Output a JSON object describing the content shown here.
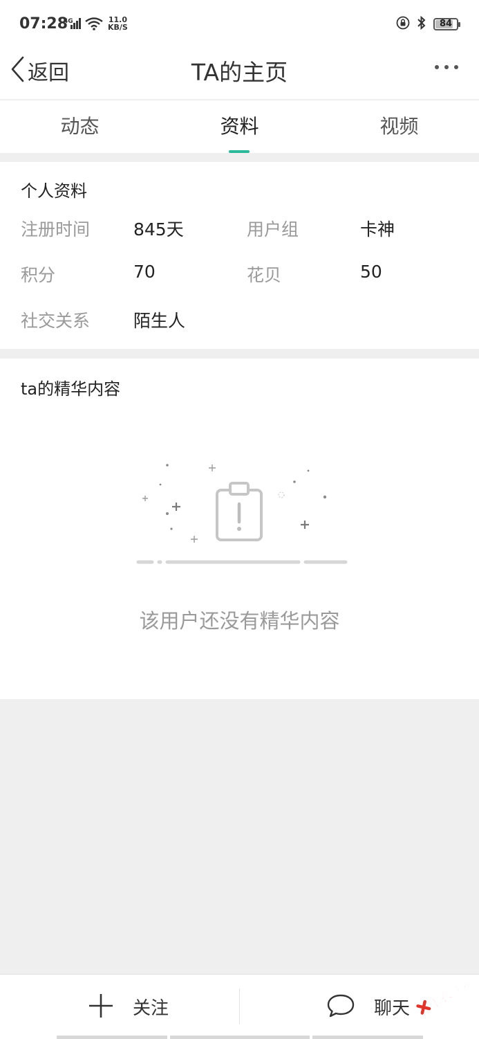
{
  "status_bar": {
    "time": "07:28",
    "network": "4G",
    "speed_value": "11.0",
    "speed_unit": "KB/S",
    "battery_level": "84",
    "icons": [
      "signal-icon",
      "wifi-icon",
      "rotation-lock-icon",
      "bluetooth-icon",
      "battery-icon"
    ]
  },
  "header": {
    "back_label": "返回",
    "title": "TA的主页",
    "more_icon": "more-dots-icon"
  },
  "tabs": [
    {
      "label": "动态",
      "active": false
    },
    {
      "label": "资料",
      "active": true
    },
    {
      "label": "视频",
      "active": false
    }
  ],
  "accent_color": "#2bb99a",
  "profile": {
    "section_title": "个人资料",
    "fields": [
      {
        "label": "注册时间",
        "value": "845天"
      },
      {
        "label": "用户组",
        "value": "卡神"
      },
      {
        "label": "积分",
        "value": "70"
      },
      {
        "label": "花贝",
        "value": "50"
      },
      {
        "label": "社交关系",
        "value": "陌生人"
      }
    ]
  },
  "featured": {
    "section_title": "ta的精华内容",
    "empty_icon": "empty-clipboard-icon",
    "empty_text": "该用户还没有精华内容"
  },
  "bottom_bar": {
    "follow_label": "关注",
    "follow_icon": "plus-icon",
    "chat_label": "聊天",
    "chat_icon": "chat-bubble-icon"
  },
  "watermark": {
    "text": "卡农社区"
  }
}
